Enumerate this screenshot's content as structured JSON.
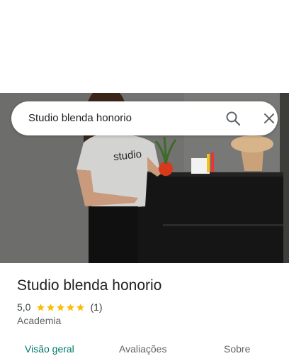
{
  "search": {
    "query": "Studio blenda honorio"
  },
  "hero": {
    "shirt_text": "studio"
  },
  "place": {
    "title": "Studio blenda honorio",
    "rating": "5,0",
    "stars": 5,
    "review_count": "(1)",
    "category": "Academia"
  },
  "tabs": [
    {
      "label": "Visão geral",
      "active": true
    },
    {
      "label": "Avaliações",
      "active": false
    },
    {
      "label": "Sobre",
      "active": false
    }
  ],
  "colors": {
    "star": "#fbbc04",
    "active_tab": "#00796b",
    "icon": "#5f6368"
  }
}
